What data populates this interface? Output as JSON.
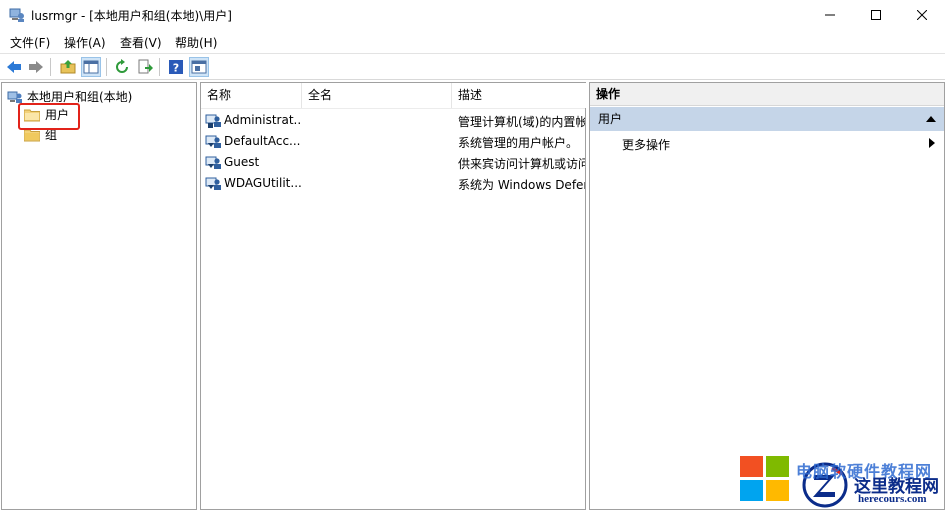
{
  "window": {
    "title": "lusrmgr - [本地用户和组(本地)\\用户]",
    "controls": {
      "minimize": "minimize-icon",
      "maximize": "maximize-icon",
      "close": "close-icon"
    }
  },
  "menu": {
    "items": [
      "文件(F)",
      "操作(A)",
      "查看(V)",
      "帮助(H)"
    ]
  },
  "toolbar": {
    "buttons": [
      "back-arrow-icon",
      "forward-arrow-icon",
      "up-folder-icon",
      "show-hide-tree-icon",
      "refresh-icon",
      "export-list-icon",
      "help-icon",
      "show-hide-action-pane-icon"
    ]
  },
  "tree": {
    "root": "本地用户和组(本地)",
    "nodes": [
      "用户",
      "组"
    ],
    "selected": "用户"
  },
  "list": {
    "columns": [
      "名称",
      "全名",
      "描述"
    ],
    "rows": [
      {
        "name": "Administrat...",
        "fullname": "",
        "desc": "管理计算机(域)的内置帐户"
      },
      {
        "name": "DefaultAcc...",
        "fullname": "",
        "desc": "系统管理的用户帐户。"
      },
      {
        "name": "Guest",
        "fullname": "",
        "desc": "供来宾访问计算机或访问域的内置帐户"
      },
      {
        "name": "WDAGUtilit...",
        "fullname": "",
        "desc": "系统为 Windows Defender 应用程序防护"
      }
    ]
  },
  "actions": {
    "header": "操作",
    "section": "用户",
    "more": "更多操作"
  },
  "watermark": {
    "line1": "电脑软硬件教程网",
    "main": "这里教程网",
    "url": "herecours.com"
  },
  "colors": {
    "accent": "#c5d5e8",
    "highlight": "#e2231a",
    "watermark": "#0b2c8a"
  }
}
